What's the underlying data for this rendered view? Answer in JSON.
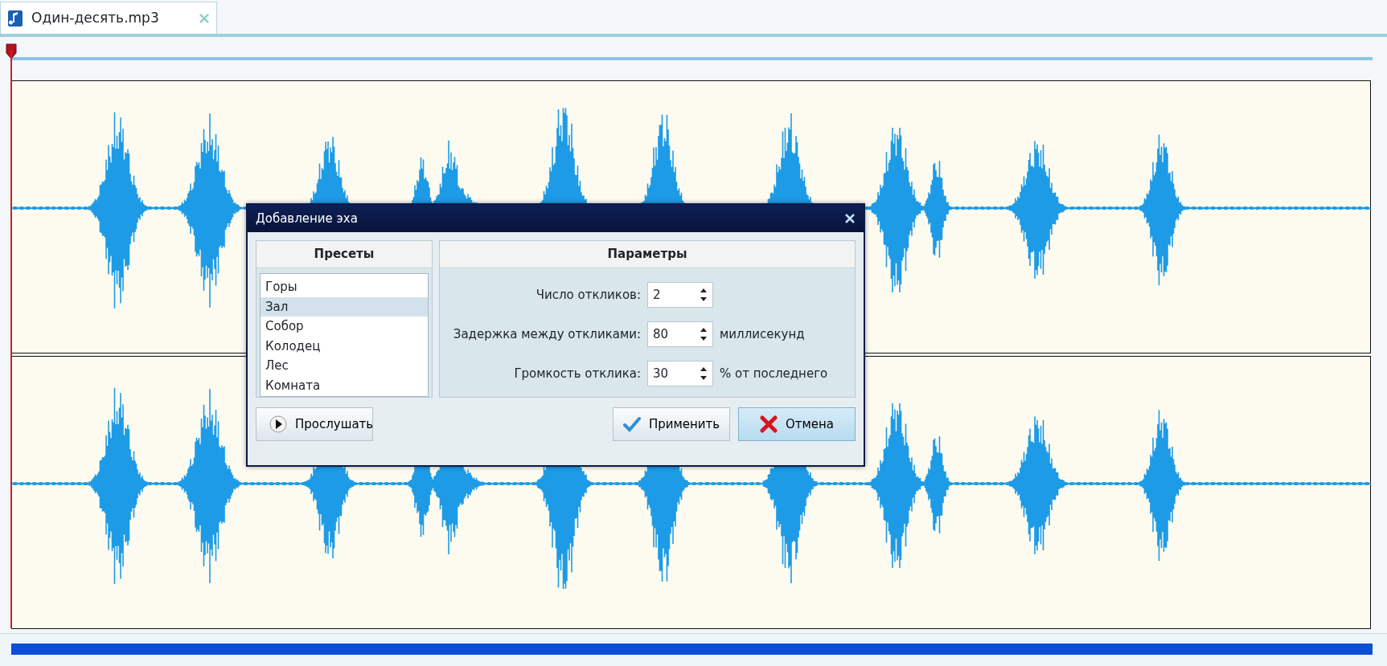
{
  "tabs": [
    {
      "label": "Один-десять.mp3",
      "selected": true
    }
  ],
  "dialog": {
    "title": "Добавление эха",
    "presets": {
      "header": "Пресеты",
      "items": [
        {
          "label": "Горы",
          "selected": false
        },
        {
          "label": "Зал",
          "selected": true
        },
        {
          "label": "Собор",
          "selected": false
        },
        {
          "label": "Колодец",
          "selected": false
        },
        {
          "label": "Лес",
          "selected": false
        },
        {
          "label": "Комната",
          "selected": false
        }
      ]
    },
    "parameters": {
      "header": "Параметры",
      "rows": [
        {
          "label": "Число откликов:",
          "value": "2"
        },
        {
          "label": "Задержка между откликами:",
          "value": "80",
          "unit": "миллисекунд"
        },
        {
          "label": "Громкость отклика:",
          "value": "30",
          "unit": "% от последнего"
        }
      ]
    },
    "buttons": [
      {
        "kind": "play",
        "label": "Прослушать",
        "focused": false
      },
      {
        "kind": "apply",
        "label": "Применить",
        "focused": false
      },
      {
        "kind": "cancel",
        "label": "Отмена",
        "focused": true
      }
    ]
  }
}
